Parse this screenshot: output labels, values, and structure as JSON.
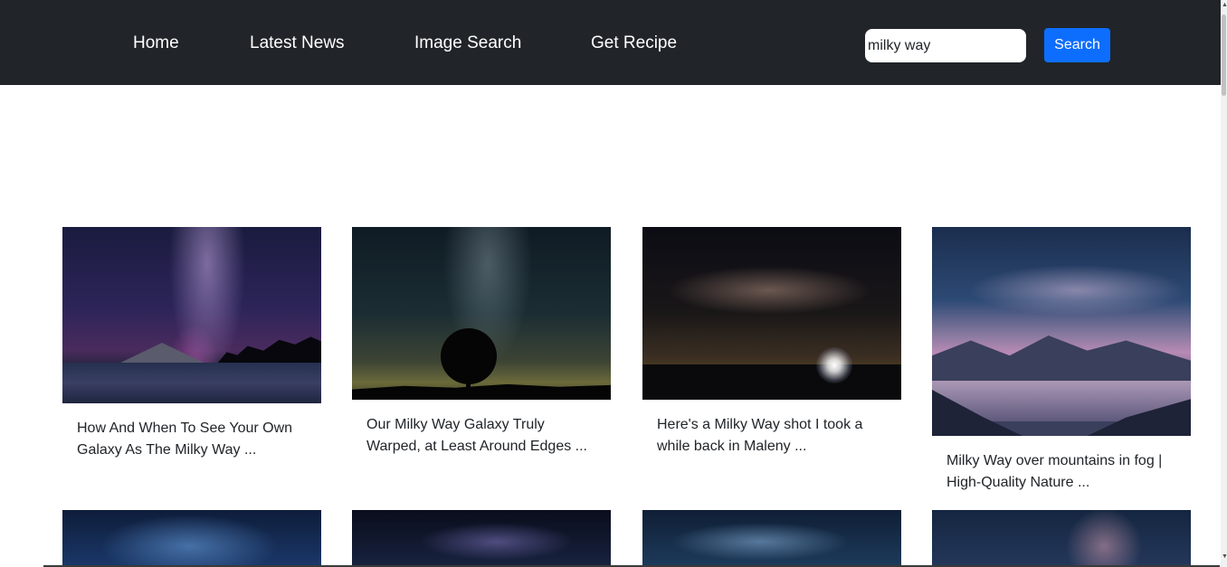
{
  "nav": {
    "links": [
      {
        "label": "Home"
      },
      {
        "label": "Latest News"
      },
      {
        "label": "Image Search"
      },
      {
        "label": "Get Recipe"
      }
    ],
    "search": {
      "value": "milky way",
      "button_label": "Search"
    }
  },
  "results": [
    {
      "caption": "How And When To See Your Own Galaxy As The Milky Way ..."
    },
    {
      "caption": "Our Milky Way Galaxy Truly Warped, at Least Around Edges ..."
    },
    {
      "caption": "Here's a Milky Way shot I took a while back in Maleny ..."
    },
    {
      "caption": "Milky Way over mountains in fog | High-Quality Nature ..."
    },
    {
      "caption": ""
    },
    {
      "caption": ""
    },
    {
      "caption": ""
    },
    {
      "caption": ""
    }
  ]
}
